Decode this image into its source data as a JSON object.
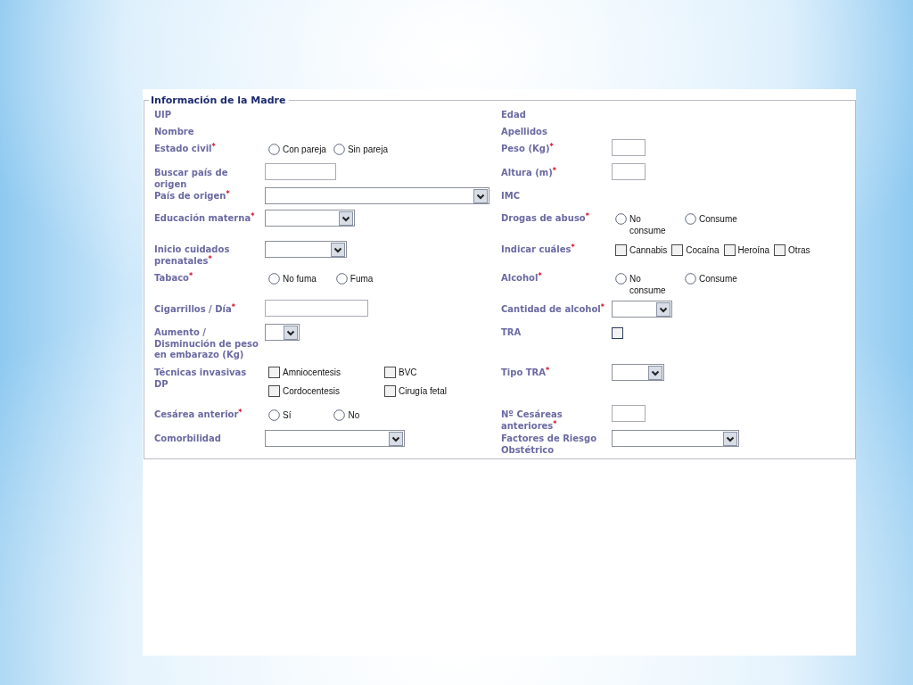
{
  "legend": "Información de la Madre",
  "rows": [
    {
      "left": {
        "label": "UIP",
        "kind": "none"
      },
      "right": {
        "label": "Edad",
        "kind": "none"
      }
    },
    {
      "left": {
        "label": "Nombre",
        "kind": "none"
      },
      "right": {
        "label": "Apellidos",
        "kind": "none"
      }
    },
    {
      "left": {
        "label": "Estado civil$^{*}$",
        "kind": "radio",
        "options": [
          {
            "label": "Con pareja",
            "selected": false
          },
          {
            "label": "Sin pareja",
            "selected": false
          }
        ]
      },
      "right": {
        "label": "Peso (Kg)$^{*}$",
        "kind": "text"
      }
    },
    {
      "left": {
        "label": "Buscar país de origen",
        "kind": "text"
      },
      "right": {
        "label": "Altura (m)$^{*}$",
        "kind": "text"
      }
    },
    {
      "left": {
        "label": "País de origen$^{*}$",
        "kind": "select"
      },
      "right": {
        "label": "IMC",
        "kind": "none"
      }
    },
    {
      "left": {
        "label": "Educación materna$^{*}$",
        "kind": "select"
      },
      "right": {
        "label": "Drogas de abuso$^{*}$",
        "kind": "radio",
        "options": [
          {
            "label": "No consume",
            "selected": false
          },
          {
            "label": "Consume",
            "selected": false
          }
        ]
      }
    },
    {
      "left": {
        "label": "Inicio cuidados prenatales$^{*}$",
        "kind": "select"
      },
      "right": {
        "label": "Indicar cuáles$^{*}$",
        "kind": "checkrow",
        "options": [
          {
            "label": "Cannabis",
            "checked": false
          },
          {
            "label": "Cocaína",
            "checked": false
          },
          {
            "label": "Heroína",
            "checked": false
          },
          {
            "label": "Otras",
            "checked": false
          }
        ]
      }
    },
    {
      "left": {
        "label": "Tabaco$^{*}$",
        "kind": "radio",
        "options": [
          {
            "label": "No fuma",
            "selected": false
          },
          {
            "label": "Fuma",
            "selected": false
          }
        ]
      },
      "right": {
        "label": "Alcohol$^{*}$",
        "kind": "radio",
        "options": [
          {
            "label": "No consume",
            "selected": false
          },
          {
            "label": "Consume",
            "selected": false
          }
        ]
      }
    },
    {
      "left": {
        "label": "Cigarrillos / Día$^{*}$",
        "kind": "text"
      },
      "right": {
        "label": "Cantidad de alcohol$^{*}$",
        "kind": "select"
      }
    },
    {
      "left": {
        "label": "Aumento / Disminución de peso en embarazo (Kg)",
        "kind": "select"
      },
      "right": {
        "label": "TRA",
        "kind": "checkbox",
        "checked": false
      }
    },
    {
      "left": {
        "label": "Técnicas invasivas DP",
        "kind": "checkgrid",
        "options": [
          {
            "label": "Amniocentesis",
            "checked": false
          },
          {
            "label": "BVC",
            "checked": false
          },
          {
            "label": "Cordocentesis",
            "checked": false
          },
          {
            "label": "Cirugía fetal",
            "checked": false
          }
        ]
      },
      "right": {
        "label": "Tipo TRA$^{*}$",
        "kind": "select"
      }
    },
    {
      "left": {
        "label": "Cesárea anterior$^{*}$",
        "kind": "radio",
        "options": [
          {
            "label": "Sí",
            "selected": false
          },
          {
            "label": "No",
            "selected": false
          }
        ]
      },
      "right": {
        "label": "Nº Cesáreas anteriores$^{*}$",
        "kind": "text"
      }
    },
    {
      "left": {
        "label": "Comorbilidad",
        "kind": "select"
      },
      "right": {
        "label": "Factores de Riesgo Obstétrico",
        "kind": "select"
      }
    }
  ]
}
